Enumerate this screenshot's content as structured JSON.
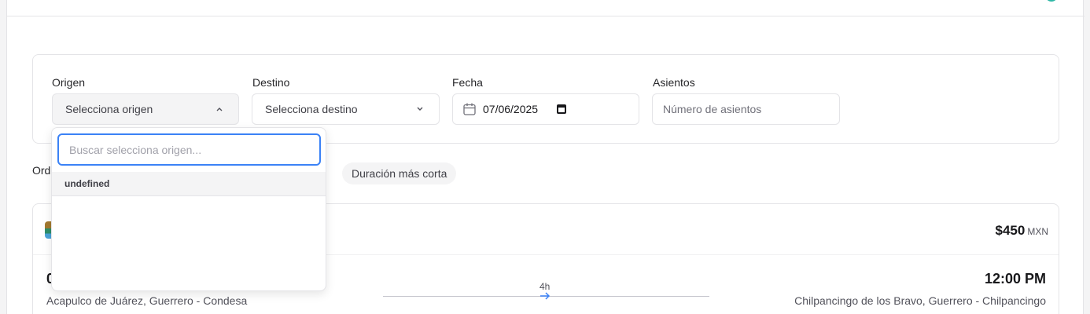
{
  "search": {
    "origin": {
      "label": "Origen",
      "value": "Selecciona origen"
    },
    "destination": {
      "label": "Destino",
      "value": "Selecciona destino"
    },
    "date": {
      "label": "Fecha",
      "value": "07/06/2025"
    },
    "seats": {
      "label": "Asientos",
      "placeholder": "Número de asientos"
    }
  },
  "origin_dropdown": {
    "search_placeholder": "Buscar selecciona origen...",
    "options": [
      "undefined"
    ]
  },
  "sort": {
    "label": "Ord",
    "chips": [
      "Duración más corta"
    ]
  },
  "result": {
    "price": "$450",
    "currency": "MXN",
    "departure_time": "0",
    "departure_location": "Acapulco de Juárez, Guerrero - Condesa",
    "duration": "4h",
    "arrival_time": "12:00 PM",
    "arrival_location": "Chilpancingo de los Bravo, Guerrero - Chilpancingo"
  },
  "colors": {
    "focus_ring": "#3b82f6",
    "avatar_ring": "#2fb7a6"
  }
}
